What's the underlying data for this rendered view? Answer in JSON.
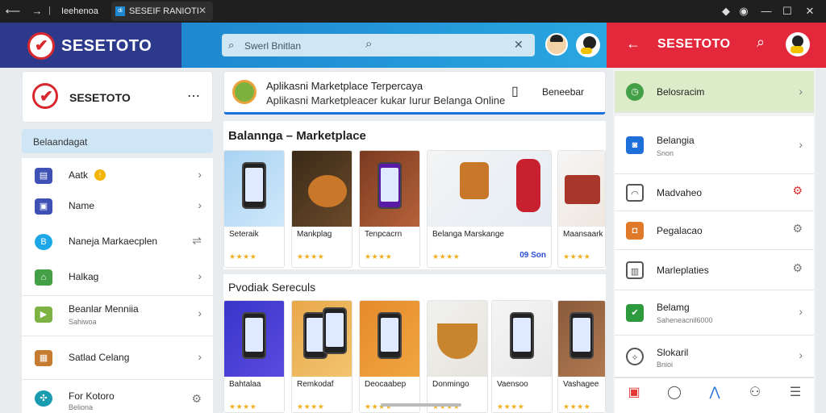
{
  "chrome": {
    "tab1": "Ieehenoa",
    "tab2": "SESEIF RANIOTI",
    "tab2_badge": "di"
  },
  "header": {
    "brand": "SESETOTO",
    "search_placeholder": "Swerl Bnitlan",
    "right_brand": "SESETOTO"
  },
  "left": {
    "app_title": "SESETOTO",
    "section_label": "Belaandagat",
    "items": [
      {
        "label": "Aatk",
        "sub": "",
        "badge": "!",
        "icon": "store-icon",
        "color": "#3f51b5"
      },
      {
        "label": "Name",
        "sub": "",
        "icon": "image-icon",
        "color": "#3f51b5"
      },
      {
        "label": "Naneja Markaecplen",
        "sub": "",
        "icon": "bag-icon",
        "color": "#1ea7e8"
      },
      {
        "label": "Halkag",
        "sub": "",
        "icon": "home-icon",
        "color": "#43a047"
      },
      {
        "label": "Beanlar Menniia",
        "sub": "Sahiwoa",
        "icon": "play-icon",
        "color": "#7cb342"
      },
      {
        "label": "Satlad Celang",
        "sub": "",
        "icon": "gift-icon",
        "color": "#c77b30"
      },
      {
        "label": "For Kotoro",
        "sub": "Beliona",
        "icon": "settings-icon",
        "color": "#1a9cb0"
      }
    ]
  },
  "main": {
    "banner_title": "Aplikasni Marketplace Terpercaya",
    "banner_sub": "Aplikasni Marketpleacer kukar Iurur Belanga Online",
    "banner_action": "Beneebar",
    "section1": "Balannga – Marketplace",
    "section2": "Pvodiak Sereculs",
    "row1": [
      {
        "name": "Seteraik",
        "stars": "★★★★",
        "price": ""
      },
      {
        "name": "Mankplag",
        "stars": "★★★★",
        "price": ""
      },
      {
        "name": "Tenpcacrn",
        "stars": "★★★★",
        "price": ""
      },
      {
        "name": "Belanga Marskange",
        "stars": "★★★★",
        "price": "09 Son"
      },
      {
        "name": "Maansaark",
        "stars": "★★★★",
        "price": ""
      }
    ],
    "row2": [
      {
        "name": "Bahtalaa",
        "stars": "★★★★"
      },
      {
        "name": "Remkodaf",
        "stars": "★★★★"
      },
      {
        "name": "Deocaabep",
        "stars": "★★★★"
      },
      {
        "name": "Donmingo",
        "stars": "★★★★"
      },
      {
        "name": "Vaensoo",
        "stars": "★★★★"
      },
      {
        "name": "Vashagee",
        "stars": "★★★★"
      }
    ]
  },
  "right": {
    "items": [
      {
        "label": "Belosracim",
        "sub": "",
        "icon": "clock-icon",
        "color": "#43a047"
      },
      {
        "label": "Belangia",
        "sub": "Snon",
        "icon": "camera-icon",
        "color": "#1e6fd9"
      },
      {
        "label": "Madvaheo",
        "sub": "",
        "icon": "chat-icon",
        "color": "#555555"
      },
      {
        "label": "Pegalacao",
        "sub": "",
        "icon": "bag-icon",
        "color": "#e07a2a"
      },
      {
        "label": "Marleplaties",
        "sub": "",
        "icon": "calendar-icon",
        "color": "#555555"
      },
      {
        "label": "Belamg",
        "sub": "Saheneacnil6000",
        "icon": "check-icon",
        "color": "#2e9a3e"
      },
      {
        "label": "Slokaril",
        "sub": "Bnioi",
        "icon": "compass-icon",
        "color": "#555555"
      }
    ],
    "nav": [
      {
        "icon": "gift-icon",
        "color": "#e53935",
        "glyph": "▣"
      },
      {
        "icon": "chat-icon",
        "color": "#555555",
        "glyph": "◯"
      },
      {
        "icon": "person-icon",
        "color": "#1e6fd9",
        "glyph": "⋀"
      },
      {
        "icon": "group-icon",
        "color": "#555555",
        "glyph": "⚇"
      },
      {
        "icon": "menu-icon",
        "color": "#555555",
        "glyph": "☰"
      }
    ]
  }
}
